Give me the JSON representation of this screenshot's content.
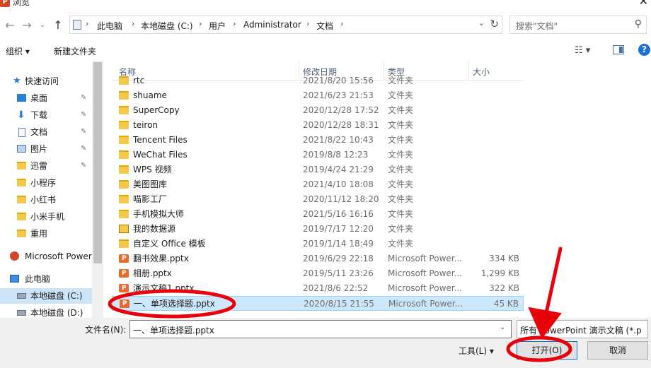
{
  "window": {
    "title": "浏览",
    "app_icon": "P"
  },
  "nav": {
    "breadcrumbs": [
      "此电脑",
      "本地磁盘 (C:)",
      "用户",
      "Administrator",
      "文档"
    ],
    "search_placeholder": "搜索\"文档\""
  },
  "toolbar": {
    "organize": "组织 ▾",
    "new_folder": "新建文件夹"
  },
  "sidebar": {
    "items": [
      {
        "label": "快速访问",
        "icon": "star-icon"
      },
      {
        "label": "桌面",
        "icon": "desktop-icon",
        "pinned": true
      },
      {
        "label": "下载",
        "icon": "download-icon",
        "pinned": true
      },
      {
        "label": "文档",
        "icon": "documents-icon",
        "pinned": true
      },
      {
        "label": "图片",
        "icon": "pictures-icon",
        "pinned": true
      },
      {
        "label": "迅雷",
        "icon": "folder-icon",
        "pinned": true
      },
      {
        "label": "小程序",
        "icon": "folder-icon"
      },
      {
        "label": "小红书",
        "icon": "folder-icon"
      },
      {
        "label": "小米手机",
        "icon": "folder-icon"
      },
      {
        "label": "重用",
        "icon": "folder-icon"
      },
      {
        "label": "Microsoft Power",
        "icon": "powerpoint-icon"
      },
      {
        "label": "此电脑",
        "icon": "computer-icon"
      },
      {
        "label": "本地磁盘 (C:)",
        "icon": "drive-icon"
      },
      {
        "label": "本地磁盘 (D:)",
        "icon": "drive-icon"
      }
    ]
  },
  "columns": {
    "name": "名称",
    "date": "修改日期",
    "type": "类型",
    "size": "大小"
  },
  "files": [
    {
      "name": "rtc",
      "date": "2021/8/20 15:56",
      "type": "文件夹",
      "size": "",
      "kind": "folder"
    },
    {
      "name": "shuame",
      "date": "2021/6/23 21:53",
      "type": "文件夹",
      "size": "",
      "kind": "folder"
    },
    {
      "name": "SuperCopy",
      "date": "2020/12/28 17:52",
      "type": "文件夹",
      "size": "",
      "kind": "folder"
    },
    {
      "name": "teiron",
      "date": "2020/12/28 18:31",
      "type": "文件夹",
      "size": "",
      "kind": "folder"
    },
    {
      "name": "Tencent Files",
      "date": "2021/8/22 10:43",
      "type": "文件夹",
      "size": "",
      "kind": "folder"
    },
    {
      "name": "WeChat Files",
      "date": "2019/8/8 12:23",
      "type": "文件夹",
      "size": "",
      "kind": "folder"
    },
    {
      "name": "WPS 视频",
      "date": "2019/4/24 21:29",
      "type": "文件夹",
      "size": "",
      "kind": "folder"
    },
    {
      "name": "美图图库",
      "date": "2021/4/10 18:08",
      "type": "文件夹",
      "size": "",
      "kind": "folder"
    },
    {
      "name": "喵影工厂",
      "date": "2020/11/12 18:20",
      "type": "文件夹",
      "size": "",
      "kind": "folder"
    },
    {
      "name": "手机模拟大师",
      "date": "2021/5/16 16:16",
      "type": "文件夹",
      "size": "",
      "kind": "folder"
    },
    {
      "name": "我的数据源",
      "date": "2019/7/17 12:20",
      "type": "文件夹",
      "size": "",
      "kind": "special"
    },
    {
      "name": "自定义 Office 模板",
      "date": "2019/1/14 18:49",
      "type": "文件夹",
      "size": "",
      "kind": "folder"
    },
    {
      "name": "翻书效果.pptx",
      "date": "2019/6/29 22:18",
      "type": "Microsoft Power...",
      "size": "334 KB",
      "kind": "pptx"
    },
    {
      "name": "相册.pptx",
      "date": "2019/5/11 23:26",
      "type": "Microsoft Power...",
      "size": "1,299 KB",
      "kind": "pptx"
    },
    {
      "name": "演示文稿1.pptx",
      "date": "2021/8/6 22:52",
      "type": "Microsoft Power...",
      "size": "322 KB",
      "kind": "pptx"
    },
    {
      "name": "一、单项选择题.pptx",
      "date": "2020/8/15 21:55",
      "type": "Microsoft Power...",
      "size": "45 KB",
      "kind": "pptx",
      "selected": true
    }
  ],
  "bottom": {
    "filename_label": "文件名(N):",
    "filename_value": "一、单项选择题.pptx",
    "filetype_value": "所有 PowerPoint 演示文稿 (*.p",
    "tools_label": "工具(L)",
    "open_label": "打开(O)",
    "cancel_label": "取消"
  },
  "colors": {
    "selection": "#cce8ff",
    "annotation": "#e8000b",
    "accent": "#0078d7"
  }
}
